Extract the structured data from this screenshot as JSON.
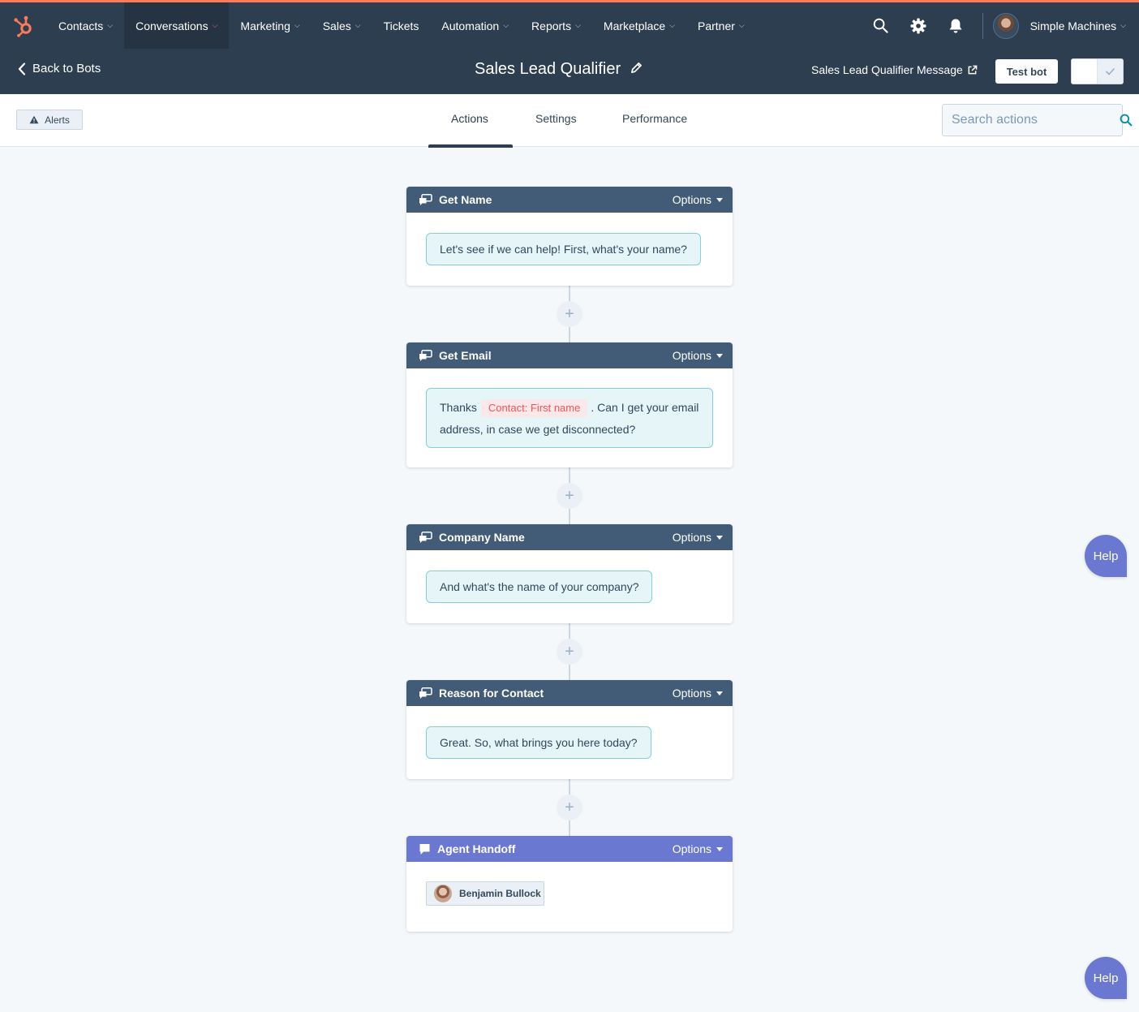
{
  "nav": {
    "items": [
      {
        "label": "Contacts",
        "dropdown": true
      },
      {
        "label": "Conversations",
        "dropdown": true,
        "active": true
      },
      {
        "label": "Marketing",
        "dropdown": true
      },
      {
        "label": "Sales",
        "dropdown": true
      },
      {
        "label": "Tickets",
        "dropdown": false
      },
      {
        "label": "Automation",
        "dropdown": true
      },
      {
        "label": "Reports",
        "dropdown": true
      },
      {
        "label": "Marketplace",
        "dropdown": true
      },
      {
        "label": "Partner",
        "dropdown": true
      }
    ],
    "account_name": "Simple Machines",
    "icons": [
      "search-icon",
      "gear-icon",
      "bell-icon"
    ],
    "accent_color": "#ff7a59"
  },
  "subheader": {
    "back_label": "Back to Bots",
    "bot_title": "Sales Lead Qualifier",
    "message_link": "Sales Lead Qualifier Message",
    "test_button": "Test bot"
  },
  "tabs_bar": {
    "alerts_label": "Alerts",
    "tabs": [
      "Actions",
      "Settings",
      "Performance"
    ],
    "active_tab": "Actions",
    "search_placeholder": "Search actions"
  },
  "actions": [
    {
      "title": "Get Name",
      "options": "Options",
      "message": "Let's see if we can help! First, what's your name?"
    },
    {
      "title": "Get Email",
      "options": "Options",
      "message_before": "Thanks",
      "token": "Contact: First name",
      "message_after": ". Can I get your email address, in case we get disconnected?"
    },
    {
      "title": "Company Name",
      "options": "Options",
      "message": "And what's the name of your company?"
    },
    {
      "title": "Reason for Contact",
      "options": "Options",
      "message": "Great. So, what brings you here today?"
    },
    {
      "title": "Agent Handoff",
      "options": "Options",
      "agent": "Benjamin Bullock"
    }
  ],
  "help_label": "Help"
}
